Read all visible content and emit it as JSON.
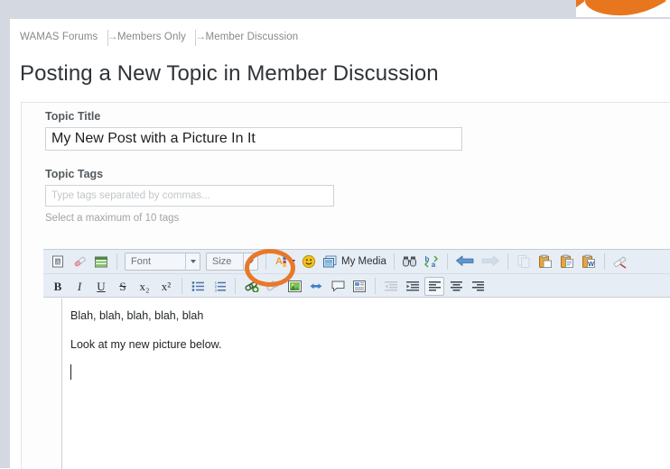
{
  "header": {
    "logo_icon": "orange-fish-logo",
    "logo_color": "#e8761f",
    "band_color": "#d4d8e1"
  },
  "breadcrumb": {
    "items": [
      "WAMAS Forums",
      "Members Only",
      "Member Discussion"
    ],
    "separator": "→"
  },
  "page": {
    "title": "Posting a New Topic in Member Discussion"
  },
  "form": {
    "topic_title_label": "Topic Title",
    "topic_title_value": "My New Post with a Picture In It",
    "topic_tags_label": "Topic Tags",
    "topic_tags_value": "",
    "topic_tags_placeholder": "Type tags separated by commas...",
    "tags_hint": "Select a maximum of 10 tags"
  },
  "editor": {
    "toolbar_row1": [
      {
        "name": "source-icon",
        "label": "",
        "type": "icon"
      },
      {
        "name": "remove-format-icon",
        "label": "",
        "type": "icon"
      },
      {
        "name": "table-icon",
        "label": "",
        "type": "icon"
      },
      {
        "name": "font-dropdown",
        "label": "Font",
        "type": "dropdown"
      },
      {
        "name": "size-dropdown",
        "label": "Size",
        "type": "dropdown"
      },
      {
        "name": "text-color-icon",
        "label": "",
        "type": "icon"
      },
      {
        "name": "smiley-icon",
        "label": "",
        "type": "icon"
      },
      {
        "name": "my-media-button",
        "label": "My Media",
        "type": "button"
      },
      {
        "name": "find-icon",
        "label": "",
        "type": "icon"
      },
      {
        "name": "spellcheck-icon",
        "label": "",
        "type": "icon"
      },
      {
        "name": "undo-icon",
        "label": "",
        "type": "icon"
      },
      {
        "name": "redo-icon",
        "label": "",
        "type": "icon"
      },
      {
        "name": "copy-icon",
        "label": "",
        "type": "icon"
      },
      {
        "name": "paste-icon",
        "label": "",
        "type": "icon"
      },
      {
        "name": "paste-text-icon",
        "label": "",
        "type": "icon"
      },
      {
        "name": "paste-word-icon",
        "label": "",
        "type": "icon"
      },
      {
        "name": "erase-format-icon",
        "label": "",
        "type": "icon"
      }
    ],
    "toolbar_row2": [
      {
        "name": "bold-button",
        "label": "B"
      },
      {
        "name": "italic-button",
        "label": "I"
      },
      {
        "name": "underline-button",
        "label": "U"
      },
      {
        "name": "strikethrough-button",
        "label": "S"
      },
      {
        "name": "subscript-button",
        "label": "x₂"
      },
      {
        "name": "superscript-button",
        "label": "x²"
      },
      {
        "name": "bulleted-list-button",
        "label": ""
      },
      {
        "name": "numbered-list-button",
        "label": ""
      },
      {
        "name": "insert-link-button",
        "label": ""
      },
      {
        "name": "unlink-button",
        "label": ""
      },
      {
        "name": "insert-image-button",
        "label": ""
      },
      {
        "name": "anchor-button",
        "label": ""
      },
      {
        "name": "comment-button",
        "label": ""
      },
      {
        "name": "template-button",
        "label": ""
      },
      {
        "name": "outdent-button",
        "label": ""
      },
      {
        "name": "indent-button",
        "label": ""
      },
      {
        "name": "align-left-button",
        "label": ""
      },
      {
        "name": "align-center-button",
        "label": ""
      },
      {
        "name": "align-right-button",
        "label": ""
      }
    ],
    "my_media_label": "My Media",
    "font_label": "Font",
    "size_label": "Size",
    "body_lines": [
      "Blah, blah, blah, blah, blah",
      "Look at my new picture below."
    ]
  },
  "annotation": {
    "name": "highlight-ellipse-insert-image",
    "color": "#e8782a",
    "target": "insert-image-button"
  }
}
